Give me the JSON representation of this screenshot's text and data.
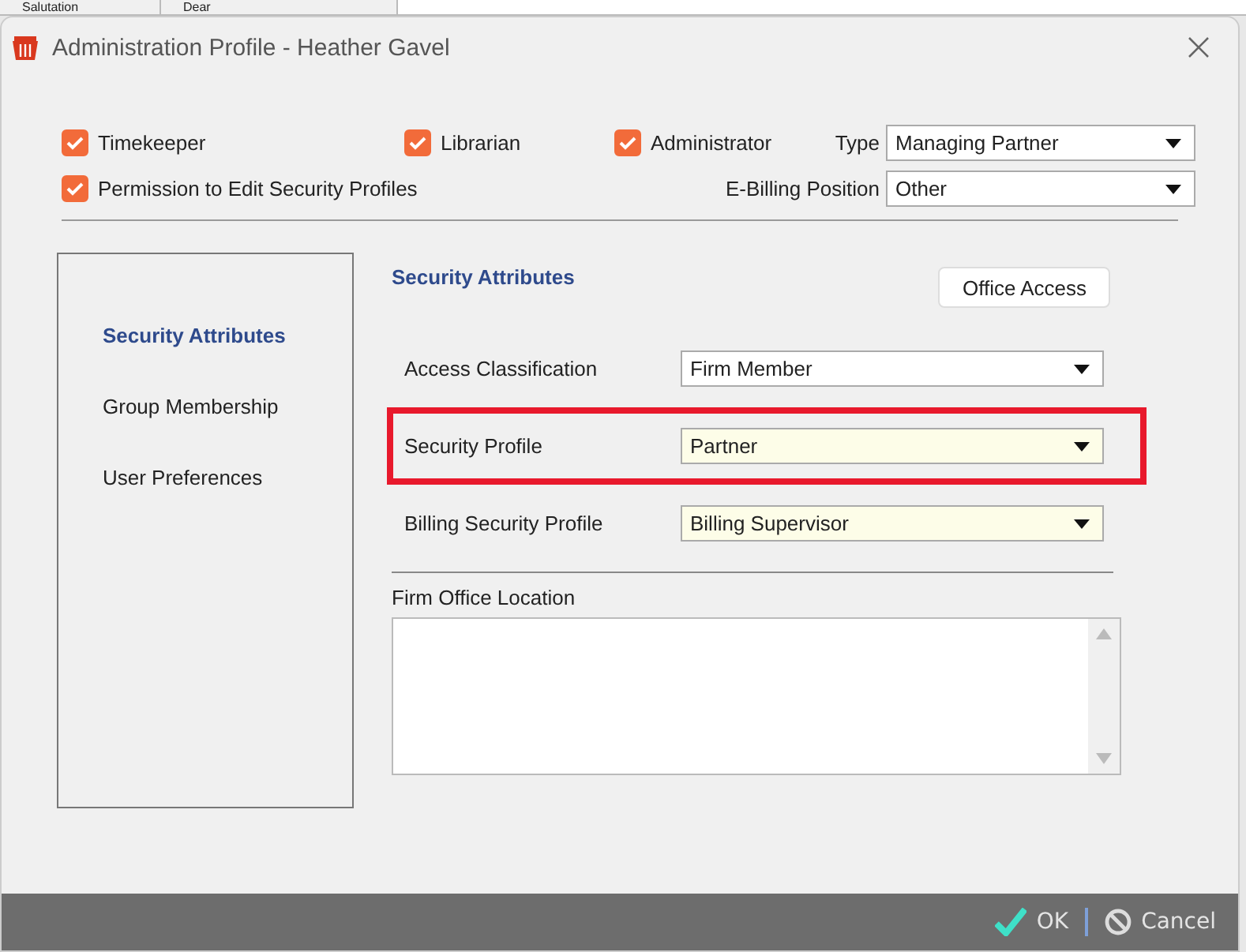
{
  "background": {
    "cells": [
      "Salutation",
      "Dear"
    ]
  },
  "window": {
    "title": "Administration Profile - Heather Gavel"
  },
  "flags": [
    {
      "label": "Timekeeper",
      "checked": true
    },
    {
      "label": "Librarian",
      "checked": true
    },
    {
      "label": "Administrator",
      "checked": true
    },
    {
      "label": "Permission to Edit Security Profiles",
      "checked": true
    }
  ],
  "type": {
    "label": "Type",
    "value": "Managing Partner"
  },
  "ebilling": {
    "label": "E-Billing Position",
    "value": "Other"
  },
  "nav": [
    {
      "label": "Security Attributes",
      "selected": true
    },
    {
      "label": "Group Membership",
      "selected": false
    },
    {
      "label": "User Preferences",
      "selected": false
    }
  ],
  "section_title": "Security Attributes",
  "office_access_button": "Office Access",
  "fields": [
    {
      "label": "Access Classification",
      "value": "Firm Member",
      "tinted": false,
      "highlighted": false
    },
    {
      "label": "Security Profile",
      "value": "Partner",
      "tinted": true,
      "highlighted": true
    },
    {
      "label": "Billing Security Profile",
      "value": "Billing Supervisor",
      "tinted": true,
      "highlighted": false
    }
  ],
  "location": {
    "label": "Firm Office Location"
  },
  "buttons": [
    {
      "label": "OK",
      "kind": "ok"
    },
    {
      "label": "Cancel",
      "kind": "cancel"
    }
  ]
}
